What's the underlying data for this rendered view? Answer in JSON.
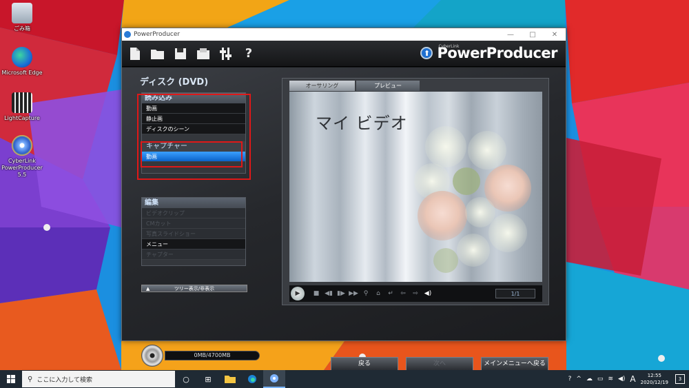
{
  "desktop": {
    "icons": [
      {
        "label": "ごみ箱",
        "name": "recycle-bin"
      },
      {
        "label": "Microsoft Edge",
        "name": "edge"
      },
      {
        "label": "LightCapture",
        "name": "lightcapture"
      },
      {
        "label": "CyberLink PowerProducer 5.5",
        "name": "powerproducer"
      }
    ]
  },
  "window": {
    "title": "PowerProducer",
    "controls": [
      "—",
      "□",
      "✕"
    ]
  },
  "toolbar": {
    "icons": [
      "new-file-icon",
      "open-folder-icon",
      "save-icon",
      "export-icon",
      "settings-icon",
      "help-icon"
    ],
    "help_glyph": "?",
    "brand_sub": "CyberLink",
    "brand_name": "PowerProducer"
  },
  "disc_title": "ディスク (DVD)",
  "import_panel": {
    "head": "読み込み",
    "items": [
      "動画",
      "静止画",
      "ディスクのシーン"
    ],
    "capture_head": "キャプチャー",
    "capture_items": [
      "動画"
    ]
  },
  "edit_panel": {
    "head": "編集",
    "items": [
      {
        "label": "ビデオクリップ",
        "enabled": false
      },
      {
        "label": "CMカット",
        "enabled": false
      },
      {
        "label": "写真スライドショー",
        "enabled": false
      },
      {
        "label": "メニュー",
        "enabled": true
      },
      {
        "label": "チャプター",
        "enabled": false
      }
    ]
  },
  "tree_toggle": "ツリー表示/非表示",
  "tabs": {
    "authoring": "オーサリング",
    "preview": "プレビュー"
  },
  "canvas_title": "マイ ビデオ",
  "player": {
    "page_counter": "1/1"
  },
  "capacity": "0MB/4700MB",
  "buttons": {
    "back": "戻る",
    "next": "次へ",
    "main_menu": "メインメニューへ戻る"
  },
  "taskbar": {
    "search_placeholder": "ここに入力して検索",
    "ime": "A",
    "time": "12:55",
    "date": "2020/12/19",
    "notifications": "3"
  },
  "colors": {
    "accent": "#1f6fd0",
    "highlight": "#e01818",
    "selected": "#0a62c8"
  }
}
